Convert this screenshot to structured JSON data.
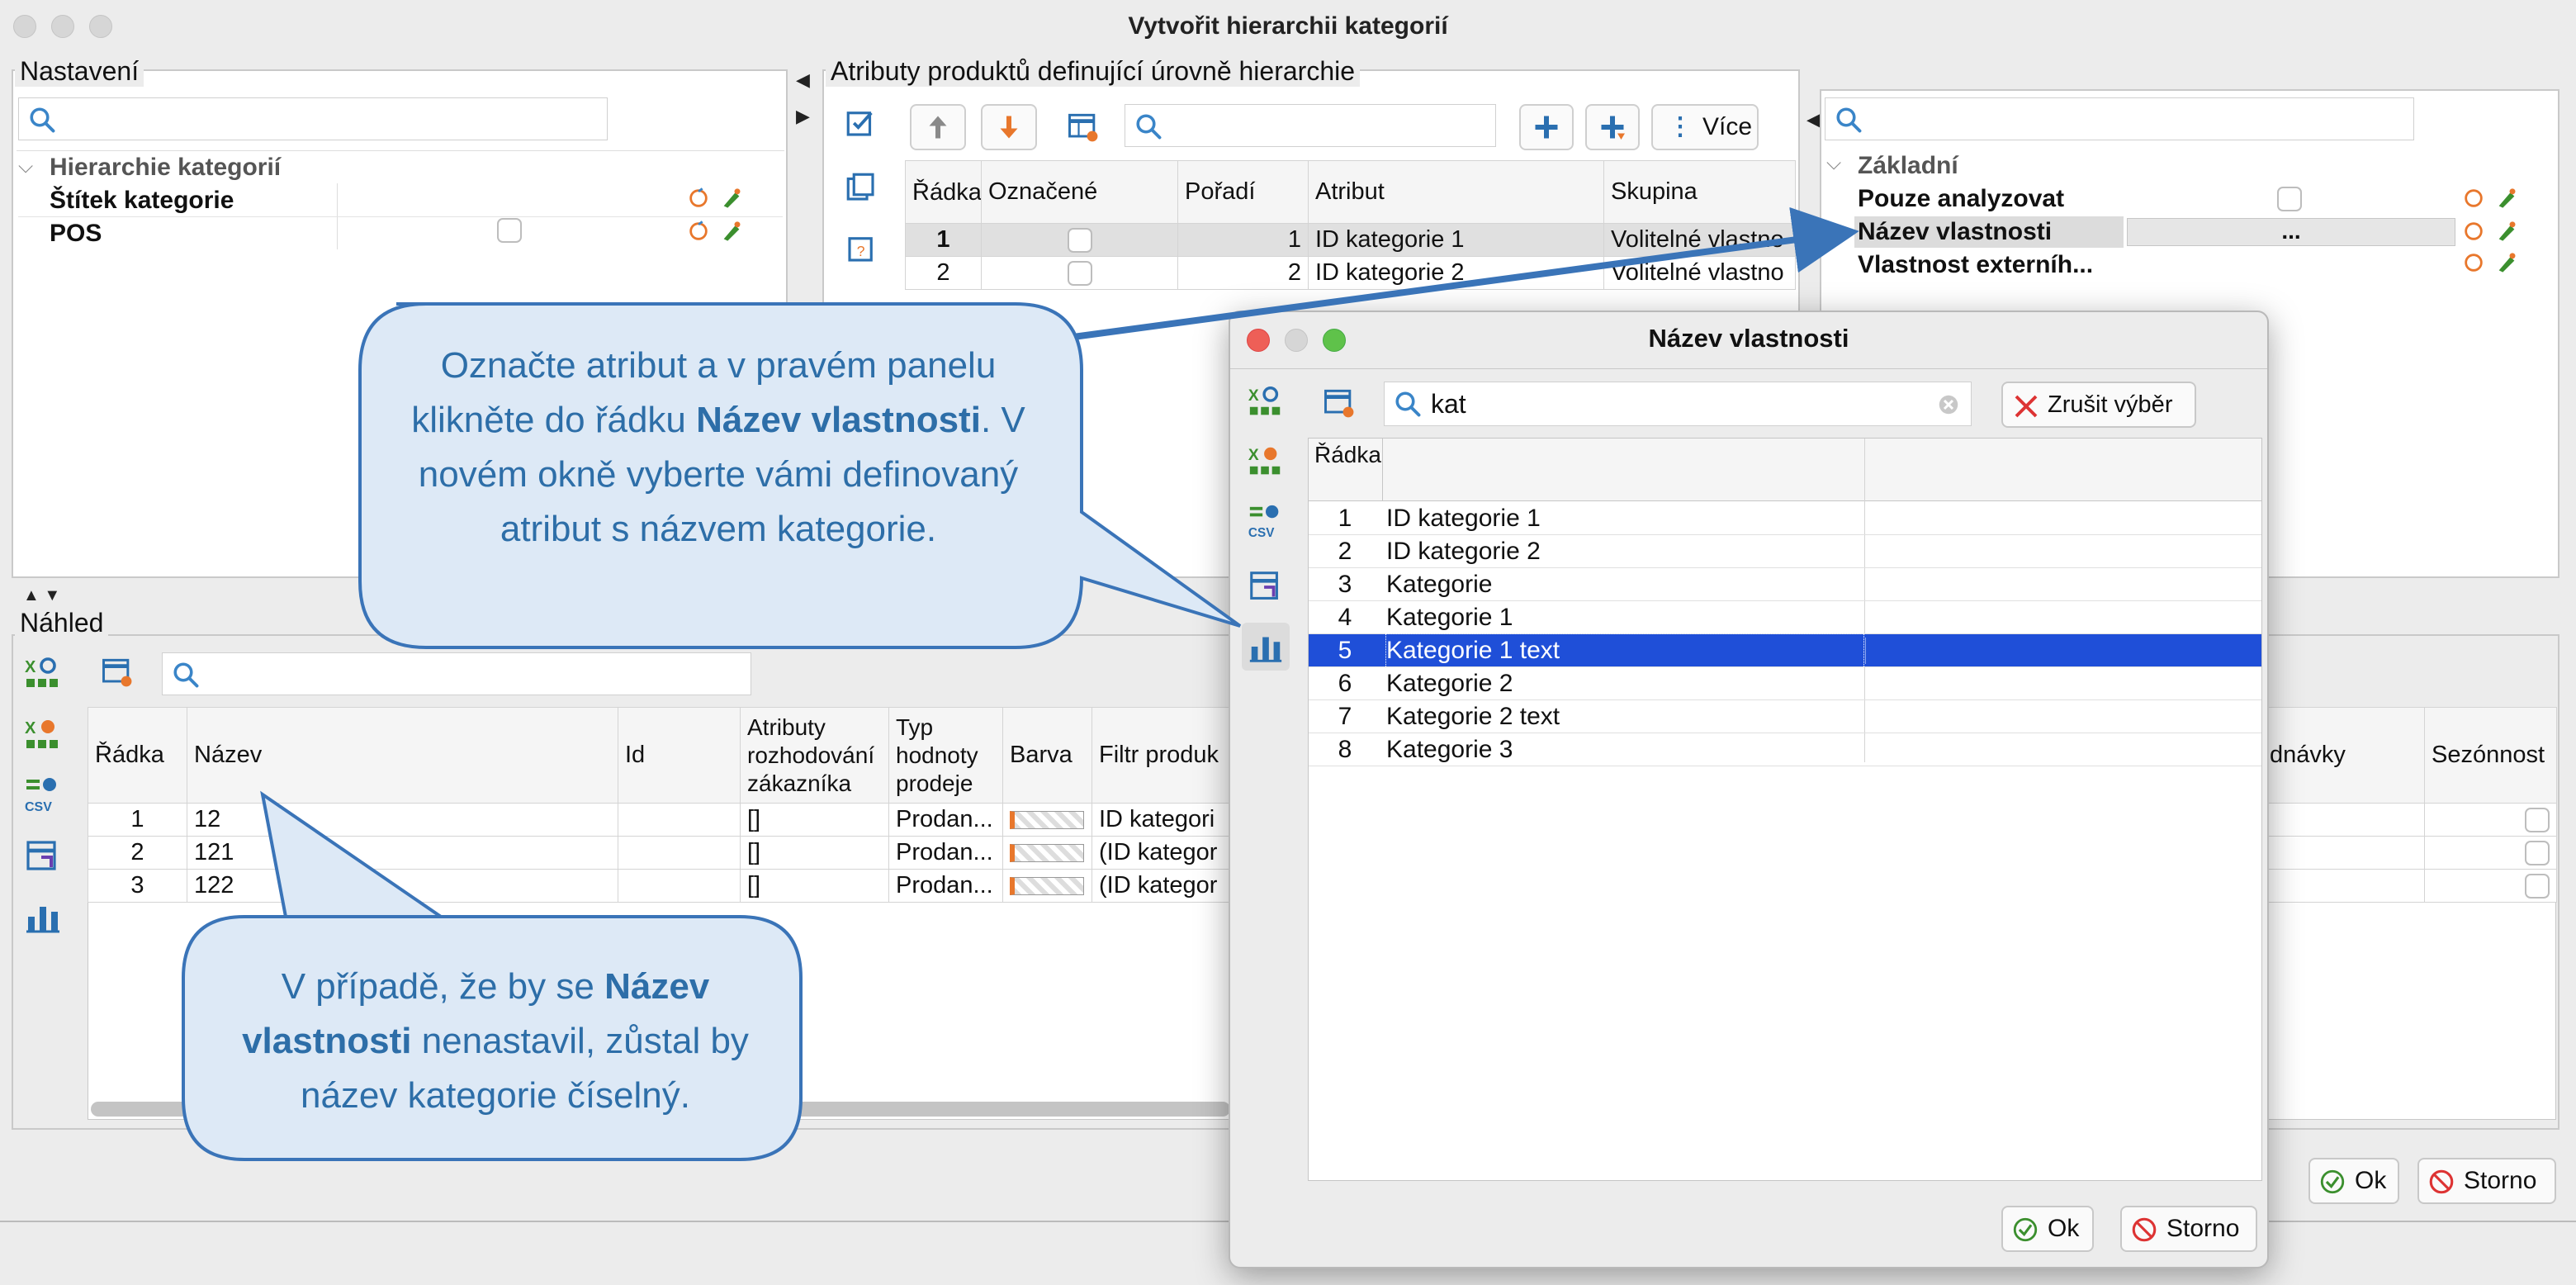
{
  "window": {
    "title": "Vytvořit hierarchii kategorií"
  },
  "nastaveni": {
    "label": "Nastavení",
    "search_placeholder": "",
    "group": "Hierarchie kategorií",
    "rows": [
      {
        "label": "Štítek kategorie"
      },
      {
        "label": "POS"
      }
    ]
  },
  "atributy": {
    "label": "Atributy produktů definující úrovně hierarchie",
    "more_label": "Více",
    "search_placeholder": "",
    "columns": [
      "Řádka",
      "Označené",
      "Pořadí",
      "Atribut",
      "Skupina"
    ],
    "rows": [
      {
        "n": "1",
        "order": "1",
        "attr": "ID kategorie 1",
        "group": "Volitelné vlastno"
      },
      {
        "n": "2",
        "order": "2",
        "attr": "ID kategorie 2",
        "group": "Volitelné vlastno"
      }
    ]
  },
  "props": {
    "group": "Základní",
    "rows": [
      {
        "label": "Pouze analyzovat",
        "value": ""
      },
      {
        "label": "Název vlastnosti",
        "value": "..."
      },
      {
        "label": "Vlastnost externíh...",
        "value": ""
      }
    ]
  },
  "nahled": {
    "label": "Náhled",
    "columns": [
      "Řádka",
      "Název",
      "Id",
      "Atributy rozhodování zákazníka",
      "Typ hodnoty prodeje",
      "Barva",
      "Filtr produk",
      "dnávky",
      "Sezónnost"
    ],
    "rows": [
      {
        "n": "1",
        "name": "12",
        "attrs": "[]",
        "type": "Prodan...",
        "filter": "ID kategori"
      },
      {
        "n": "2",
        "name": "121",
        "attrs": "[]",
        "type": "Prodan...",
        "filter": "(ID kategor"
      },
      {
        "n": "3",
        "name": "122",
        "attrs": "[]",
        "type": "Prodan...",
        "filter": "(ID kategor"
      }
    ]
  },
  "main_buttons": {
    "ok": "Ok",
    "cancel": "Storno"
  },
  "dialog": {
    "title": "Název vlastnosti",
    "search_value": "kat",
    "clear_label": "Zrušit výběr",
    "col_header": "Řádka",
    "selected_index": 4,
    "rows": [
      {
        "n": "1",
        "name": "ID kategorie 1"
      },
      {
        "n": "2",
        "name": "ID kategorie 2"
      },
      {
        "n": "3",
        "name": "Kategorie"
      },
      {
        "n": "4",
        "name": "Kategorie 1"
      },
      {
        "n": "5",
        "name": "Kategorie 1 text"
      },
      {
        "n": "6",
        "name": "Kategorie 2"
      },
      {
        "n": "7",
        "name": "Kategorie 2 text"
      },
      {
        "n": "8",
        "name": "Kategorie 3"
      }
    ],
    "ok": "Ok",
    "cancel": "Storno"
  },
  "callouts": {
    "top": {
      "part1": "Označte atribut a v pravém panelu klikněte do řádku ",
      "bold": "Název vlastnosti",
      "part2": ". V novém okně vyberte vámi definovaný atribut s názvem kategorie."
    },
    "bottom": {
      "part1": "V případě, že by se ",
      "bold": "Název vlastnosti",
      "part2": " nenastavil, zůstal by název kategorie číselný."
    }
  },
  "colors": {
    "accent_blue": "#2d6ea8",
    "callout_fill": "#dde9f6",
    "selection": "#1f4fd8",
    "icon_green": "#3b8f2e",
    "icon_blue": "#2a6fb0",
    "orange": "#e8772c"
  }
}
